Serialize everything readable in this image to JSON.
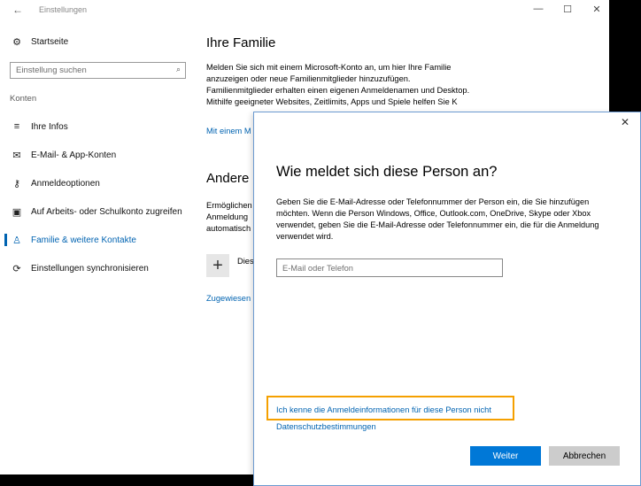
{
  "window": {
    "title": "Einstellungen",
    "back_glyph": "←",
    "controls": {
      "minimize": "—",
      "maximize": "☐",
      "close": "✕"
    }
  },
  "sidebar": {
    "home": {
      "label": "Startseite",
      "icon": "gear-icon",
      "glyph": "⚙"
    },
    "search": {
      "placeholder": "Einstellung suchen",
      "value": "",
      "icon": "search-icon",
      "glyph": "⌕"
    },
    "section": "Konten",
    "items": [
      {
        "label": "Ihre Infos",
        "icon": "user-info-icon",
        "glyph": "≡"
      },
      {
        "label": "E-Mail- & App-Konten",
        "icon": "mail-icon",
        "glyph": "✉"
      },
      {
        "label": "Anmeldeoptionen",
        "icon": "key-icon",
        "glyph": "⚷"
      },
      {
        "label": "Auf Arbeits- oder Schulkonto zugreifen",
        "icon": "briefcase-icon",
        "glyph": "▣"
      },
      {
        "label": "Familie & weitere Kontakte",
        "icon": "person-icon",
        "glyph": "♙"
      },
      {
        "label": "Einstellungen synchronisieren",
        "icon": "sync-icon",
        "glyph": "⟳"
      }
    ],
    "active_index": 4
  },
  "main": {
    "family_title": "Ihre Familie",
    "family_text": "Melden Sie sich mit einem Microsoft-Konto an, um hier Ihre Familie anzuzeigen oder neue Familienmitglieder hinzuzufügen. Familienmitglieder erhalten einen eigenen Anmeldenamen und Desktop. Mithilfe geeigneter Websites, Zeitlimits, Apps und Spiele helfen Sie K",
    "family_link": "Mit einem M",
    "others_title": "Andere",
    "others_text": "Ermöglichen Anmeldung automatisch",
    "add_glyph": "+",
    "add_label": "Dies",
    "assigned_link": "Zugewiesen"
  },
  "dialog": {
    "close_glyph": "✕",
    "title": "Wie meldet sich diese Person an?",
    "text": "Geben Sie die E-Mail-Adresse oder Telefonnummer der Person ein, die Sie hinzufügen möchten. Wenn die Person Windows, Office, Outlook.com, OneDrive, Skype oder Xbox verwendet, geben Sie die E-Mail-Adresse oder Telefonnummer ein, die für die Anmeldung verwendet wird.",
    "email_placeholder": "E-Mail oder Telefon",
    "email_value": "",
    "no_credentials_link": "Ich kenne die Anmeldeinformationen für diese Person nicht",
    "privacy_link": "Datenschutzbestimmungen",
    "next_button": "Weiter",
    "cancel_button": "Abbrechen",
    "highlight_color": "#f5a000",
    "accent_color": "#0078d7"
  }
}
